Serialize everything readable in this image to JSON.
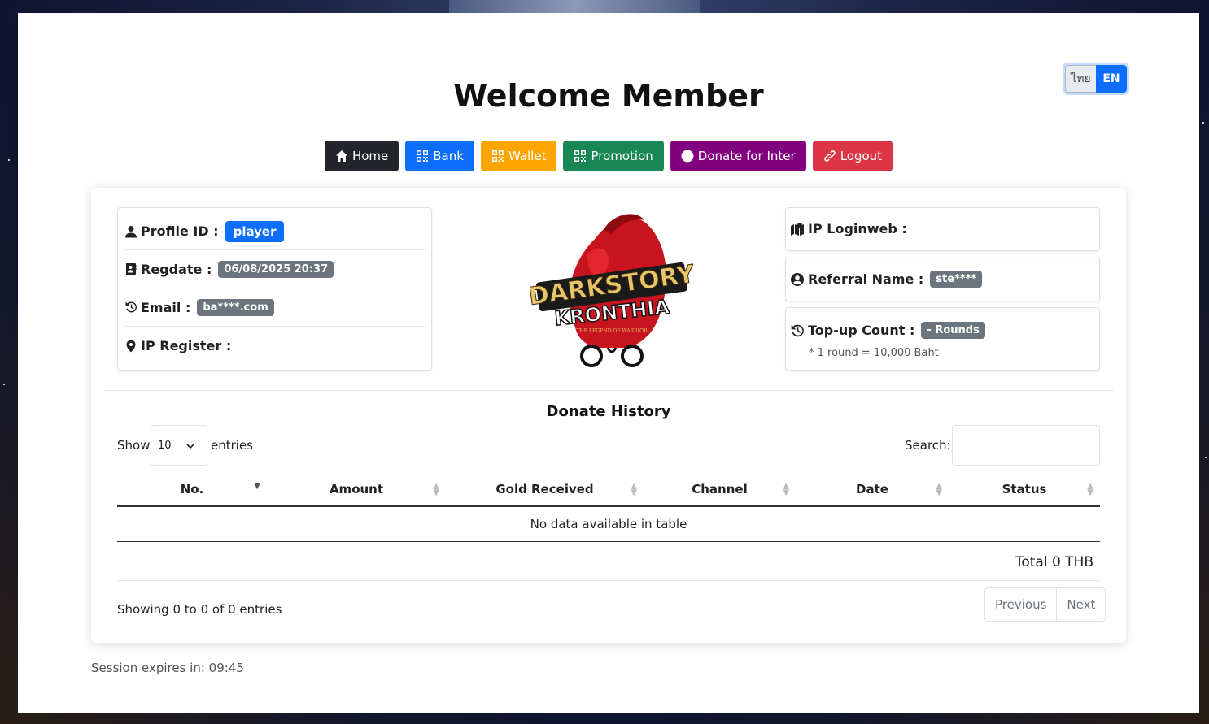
{
  "lang": {
    "th": "ไทย",
    "en": "EN"
  },
  "title": "Welcome Member",
  "nav": [
    {
      "label": "Home",
      "color": "#212529"
    },
    {
      "label": "Bank",
      "color": "#0d6efd"
    },
    {
      "label": "Wallet",
      "color": "#ffa500"
    },
    {
      "label": "Promotion",
      "color": "#198754"
    },
    {
      "label": "Donate for Inter",
      "color": "#800080"
    },
    {
      "label": "Logout",
      "color": "#dc3545"
    }
  ],
  "profile": {
    "id_label": "Profile ID :",
    "id_value": "player",
    "regdate_label": "Regdate :",
    "regdate_value": "06/08/2025 20:37",
    "email_label": "Email :",
    "email_value": "ba****.com",
    "ip_register_label": "IP Register :"
  },
  "logo": {
    "line1": "DARKSTORY",
    "line2": "KRONTHIA",
    "tagline": "THE LEGEND OF WARRIOR"
  },
  "info": {
    "ip_loginweb_label": "IP Loginweb :",
    "referral_label": "Referral Name :",
    "referral_value": "ste****",
    "topup_label": "Top-up Count :",
    "topup_value": "- Rounds",
    "topup_note": "* 1 round = 10,000 Baht"
  },
  "history": {
    "title": "Donate History",
    "show_label": "Show",
    "entries_value": "10",
    "entries_label": "entries",
    "search_label": "Search:",
    "columns": [
      "No.",
      "Amount",
      "Gold Received",
      "Channel",
      "Date",
      "Status"
    ],
    "empty_text": "No data available in table",
    "total_text": "Total 0 THB",
    "showing_text": "Showing 0 to 0 of 0 entries",
    "prev_label": "Previous",
    "next_label": "Next"
  },
  "session": "Session expires in: 09:45"
}
